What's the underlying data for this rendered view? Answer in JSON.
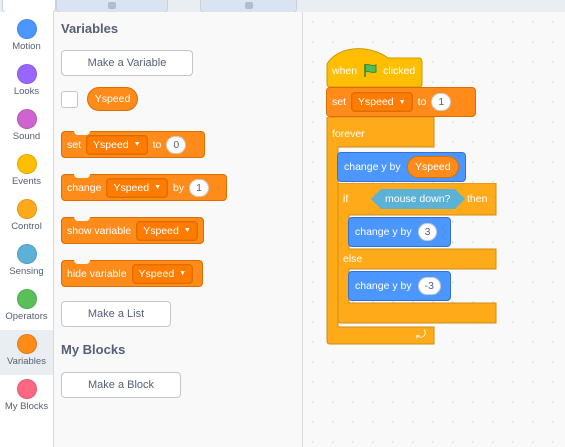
{
  "categories": [
    {
      "label": "Motion",
      "color": "#4c97ff"
    },
    {
      "label": "Looks",
      "color": "#9966ff"
    },
    {
      "label": "Sound",
      "color": "#cf63cf"
    },
    {
      "label": "Events",
      "color": "#ffbf00"
    },
    {
      "label": "Control",
      "color": "#ffab19"
    },
    {
      "label": "Sensing",
      "color": "#5cb1d6"
    },
    {
      "label": "Operators",
      "color": "#59c059"
    },
    {
      "label": "Variables",
      "color": "#ff8c1a"
    },
    {
      "label": "My Blocks",
      "color": "#ff6680"
    }
  ],
  "selected_category": "Variables",
  "palette": {
    "variables_title": "Variables",
    "make_variable": "Make a Variable",
    "variable_name": "Yspeed",
    "set_block": {
      "verb": "set",
      "var": "Yspeed",
      "to": "to",
      "value": "0"
    },
    "change_block": {
      "verb": "change",
      "var": "Yspeed",
      "by": "by",
      "value": "1"
    },
    "show_block": {
      "verb": "show variable",
      "var": "Yspeed"
    },
    "hide_block": {
      "verb": "hide variable",
      "var": "Yspeed"
    },
    "make_list": "Make a List",
    "myblocks_title": "My Blocks",
    "make_block": "Make a Block"
  },
  "script": {
    "hat": {
      "when": "when",
      "flag_icon": "green-flag-icon",
      "clicked": "clicked"
    },
    "set": {
      "verb": "set",
      "var": "Yspeed",
      "to": "to",
      "value": "1"
    },
    "forever": "forever",
    "change_y_var": {
      "label": "change y by",
      "var": "Yspeed"
    },
    "if_label": "if",
    "condition": "mouse down?",
    "then_label": "then",
    "change_y_up": {
      "label": "change y by",
      "value": "3"
    },
    "else_label": "else",
    "change_y_down": {
      "label": "change y by",
      "value": "-3"
    },
    "loop_arrow": "⤾"
  }
}
